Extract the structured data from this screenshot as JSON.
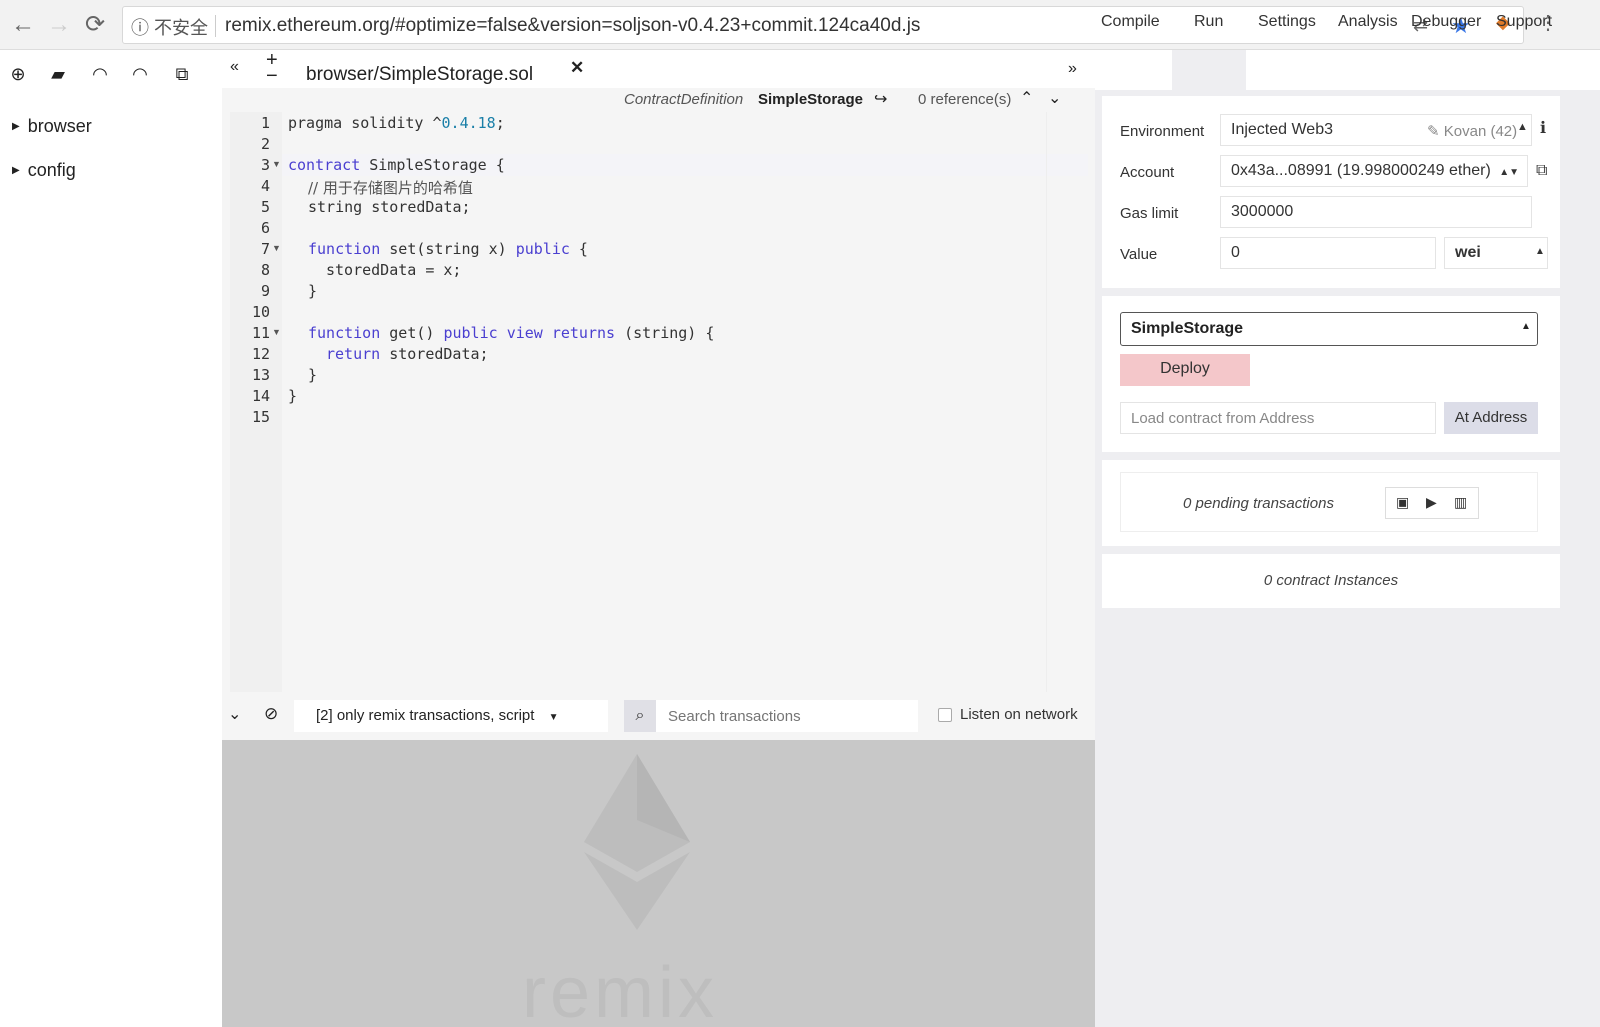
{
  "browser": {
    "back_icon": "←",
    "forward_icon": "→",
    "reload_icon": "⟳",
    "security_label": "不安全",
    "url": "remix.ethereum.org/#optimize=false&version=soljson-v0.4.23+commit.124ca40d.js"
  },
  "file_toolbar": {
    "icons": [
      "new-file-icon",
      "open-folder-icon",
      "github-icon",
      "github-gist-icon",
      "copy-icon"
    ]
  },
  "file_tree": {
    "items": [
      {
        "label": "browser"
      },
      {
        "label": "config"
      }
    ]
  },
  "editor": {
    "tab_title": "browser/SimpleStorage.sol",
    "context": {
      "kind": "ContractDefinition",
      "name": "SimpleStorage",
      "references": "0 reference(s)"
    },
    "line_numbers": [
      "1",
      "2",
      "3",
      "4",
      "5",
      "6",
      "7",
      "8",
      "9",
      "10",
      "11",
      "12",
      "13",
      "14",
      "15"
    ]
  },
  "right_tabs": [
    "Compile",
    "Run",
    "Settings",
    "Analysis",
    "Debugger",
    "Support"
  ],
  "run": {
    "environment_label": "Environment",
    "environment_value": "Injected Web3",
    "network": "Kovan (42)",
    "account_label": "Account",
    "account_value": "0x43a...08991 (19.998000249 ether)",
    "gas_label": "Gas limit",
    "gas_value": "3000000",
    "value_label": "Value",
    "value_value": "0",
    "value_unit": "wei",
    "contract_selected": "SimpleStorage",
    "deploy_label": "Deploy",
    "load_placeholder": "Load contract from Address",
    "at_address_label": "At Address",
    "pending_text": "0 pending transactions",
    "instances_text": "0 contract Instances"
  },
  "terminal": {
    "filter_label": "[2] only remix transactions, script",
    "search_placeholder": "Search transactions",
    "listen_label": "Listen on network",
    "watermark": "remix"
  },
  "colors": {
    "deploy": "#f4c7ca",
    "keyword": "#4a3fd0",
    "terminal_bg": "#c8c8c8"
  }
}
